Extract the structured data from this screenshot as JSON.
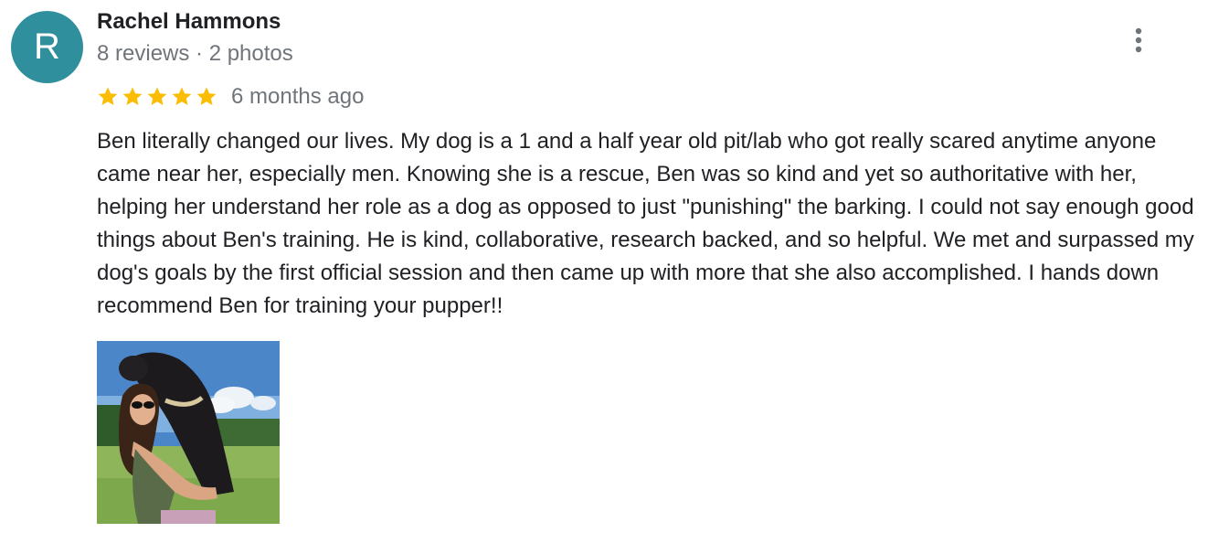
{
  "review": {
    "author": {
      "initial": "R",
      "name": "Rachel Hammons",
      "meta": "8 reviews · 2 photos",
      "avatar_color": "#2f8f9d"
    },
    "rating": {
      "stars": 5,
      "max": 5,
      "star_color": "#fbbc04"
    },
    "time_ago": "6 months ago",
    "text": "Ben literally changed our lives. My dog is a 1 and a half year old pit/lab who got really scared anytime anyone came near her, especially men. Knowing she is a rescue, Ben was so kind and yet so authoritative with her, helping her understand her role as a dog as opposed to just \"punishing\" the barking. I could not say enough good things about Ben's training. He is kind, collaborative, research backed, and so helpful. We met and surpassed my dog's goals by the first official session and then came up with more that she also accomplished. I hands down recommend Ben for training your pupper!!",
    "more_icon": "more-vert-icon",
    "photo_icon": "review-photo-thumbnail"
  }
}
